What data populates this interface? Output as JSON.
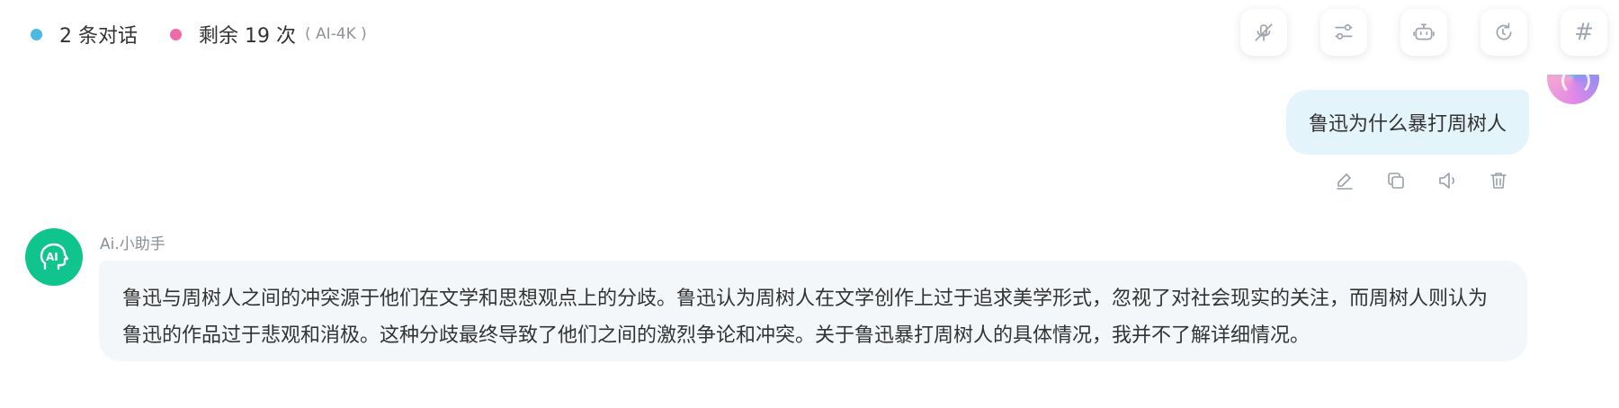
{
  "header": {
    "conversation_count": "2 条对话",
    "remaining": "剩余 19 次",
    "model_tag": "( AI-4K )"
  },
  "toolbar": {
    "buttons": [
      {
        "icon": "mute-icon"
      },
      {
        "icon": "settings-sliders-icon"
      },
      {
        "icon": "robot-icon"
      },
      {
        "icon": "refresh-icon"
      },
      {
        "icon": "hash-icon",
        "glyph": "#"
      }
    ]
  },
  "messages": {
    "user": {
      "text": "鲁迅为什么暴打周树人",
      "actions": [
        "edit-icon",
        "copy-icon",
        "speaker-icon",
        "delete-icon"
      ]
    },
    "assistant": {
      "name": "Ai.小助手",
      "text": "鲁迅与周树人之间的冲突源于他们在文学和思想观点上的分歧。鲁迅认为周树人在文学创作上过于追求美学形式，忽视了对社会现实的关注，而周树人则认为鲁迅的作品过于悲观和消极。这种分歧最终导致了他们之间的激烈争论和冲突。关于鲁迅暴打周树人的具体情况，我并不了解详细情况。"
    }
  },
  "colors": {
    "dot_blue": "#4db8e0",
    "dot_pink": "#f06aa8",
    "user_bubble": "#e4f4fb",
    "ai_bubble": "#f4f7f9",
    "ai_avatar": "#10c48d"
  }
}
